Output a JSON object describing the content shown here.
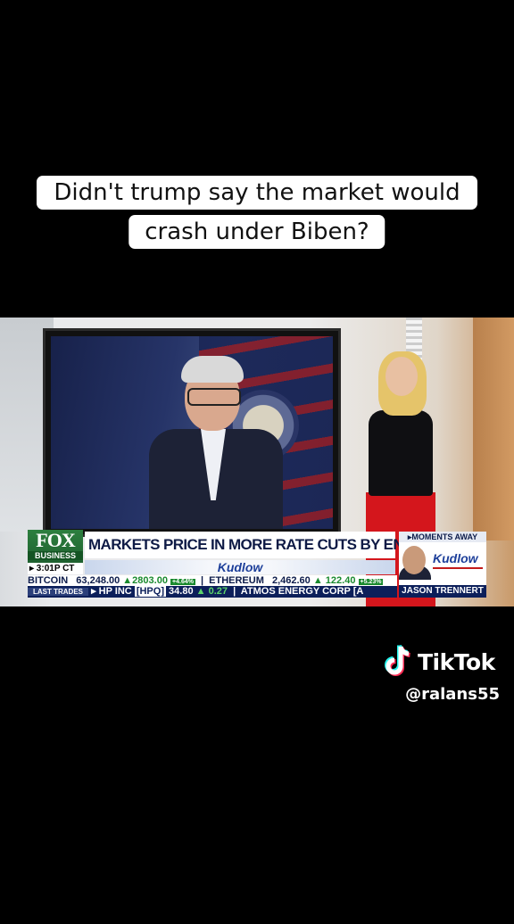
{
  "caption": {
    "line1": "Didn't trump say the market would",
    "line2": "crash under Biben?"
  },
  "chyron": {
    "network_line1": "FOX",
    "network_line2": "BUSINESS",
    "time": "▸ 3:01P CT",
    "headline": "MARKETS PRICE IN MORE RATE CUTS BY END OF YEAR",
    "show": "Kudlow",
    "ticker1": {
      "bitcoin_label": "BITCOIN",
      "bitcoin_price": "63,248.00",
      "bitcoin_change": "▲2803.00",
      "bitcoin_pct": "+4.64%",
      "eth_label": "ETHEREUM",
      "eth_price": "2,462.60",
      "eth_change": "▲ 122.40",
      "eth_pct": "+5.23%"
    },
    "ticker2": {
      "label": "LAST TRADES",
      "arrow": "▸",
      "stock1_name": "HP INC",
      "stock1_symbol": "[HPQ]",
      "stock1_price": "34.80",
      "stock1_change": "▲ 0.27",
      "stock2_name": "ATMOS ENERGY CORP [A"
    },
    "promo": {
      "header": "▸MOMENTS AWAY",
      "show": "Kudlow",
      "name": "JASON TRENNERT"
    }
  },
  "watermark": {
    "brand": "TikTok",
    "handle": "@ralans55",
    "logo_icon": "tiktok-note-icon"
  }
}
